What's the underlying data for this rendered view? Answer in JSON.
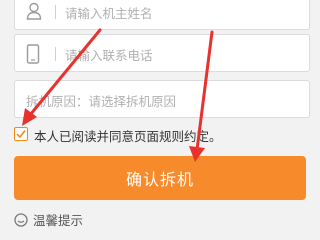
{
  "form": {
    "name_placeholder": "请输入机主姓名",
    "phone_placeholder": "请输入联系电话",
    "reason_placeholder": "拆机原因：请选择拆机原因",
    "agree_checked": true,
    "agree_label": "本人已阅读并同意页面规则约定。",
    "confirm_label": "确认拆机"
  },
  "tips": {
    "label": "温馨提示"
  },
  "icons": {
    "name": "user-icon",
    "phone": "phone-icon",
    "check": "checkmark-icon",
    "tips": "smile-icon"
  },
  "colors": {
    "accent": "#f78a2a",
    "annotation_arrow": "#e8322e"
  }
}
